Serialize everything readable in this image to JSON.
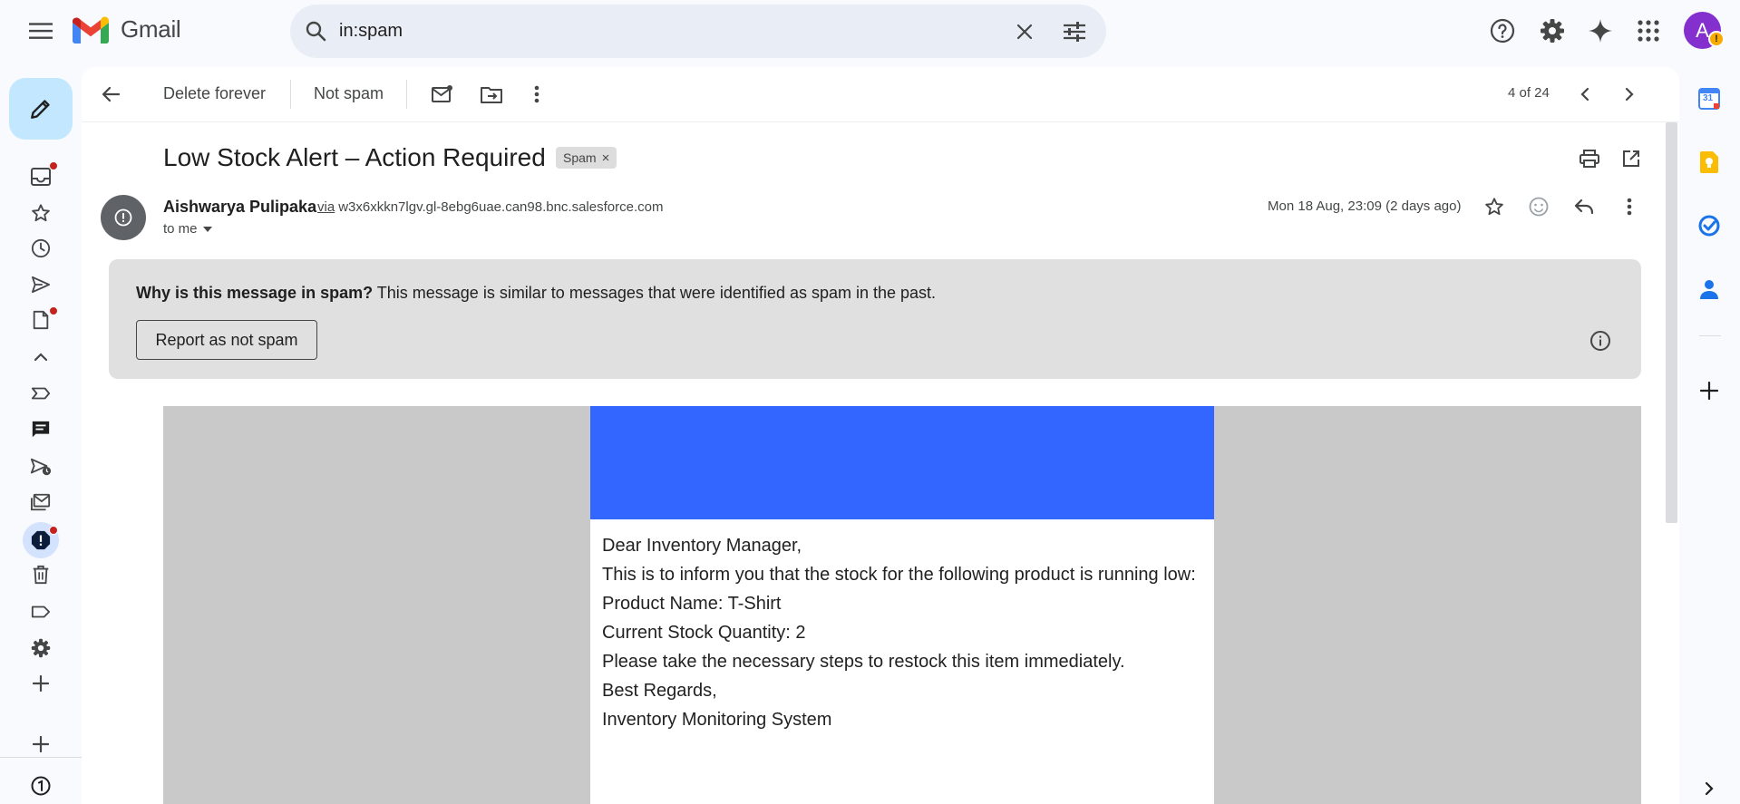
{
  "app": {
    "name": "Gmail"
  },
  "search": {
    "value": "in:spam"
  },
  "account": {
    "avatar_letter": "A",
    "badge": "!"
  },
  "toolbar": {
    "delete_forever": "Delete forever",
    "not_spam": "Not spam",
    "pager": "4 of 24"
  },
  "message": {
    "subject": "Low Stock Alert – Action Required",
    "label_chip": "Spam",
    "label_chip_close": "×",
    "sender_name": "Aishwarya Pulipaka",
    "via_word": "via",
    "via_domain": "w3x6xkkn7lgv.gl-8ebg6uae.can98.bnc.salesforce.com",
    "recipient": "to me",
    "date": "Mon 18 Aug, 23:09 (2 days ago)"
  },
  "spam_warning": {
    "question": "Why is this message in spam?",
    "explanation": " This message is similar to messages that were identified as spam in the past.",
    "button": "Report as not spam"
  },
  "email_body": {
    "lines": [
      "Dear Inventory Manager,",
      "This is to inform you that the stock for the following product is running low:",
      "Product Name: T-Shirt",
      "Current Stock Quantity: 2",
      "Please take the necessary steps to restock this item immediately.",
      "Best Regards,",
      "Inventory Monitoring System"
    ]
  },
  "calendar_icon": {
    "date": "31"
  },
  "colors": {
    "banner": "#3366ff",
    "compose_bg": "#c2e7ff",
    "avatar": "#8430ce",
    "spam_box": "#e0e0e0",
    "unread_dot": "#c5221f"
  },
  "icons": {
    "left_rail": [
      "inbox-icon",
      "star-icon",
      "clock-icon",
      "send-icon",
      "draft-icon",
      "chevron-up-icon",
      "label-important-icon",
      "chat-icon",
      "scheduled-send-icon",
      "all-mail-icon",
      "spam-icon",
      "trash-icon",
      "label-icon",
      "settings-icon",
      "plus-icon",
      "plus-icon"
    ],
    "right_rail": [
      "calendar-icon",
      "keep-icon",
      "tasks-icon",
      "contacts-icon",
      "plus-icon"
    ]
  }
}
